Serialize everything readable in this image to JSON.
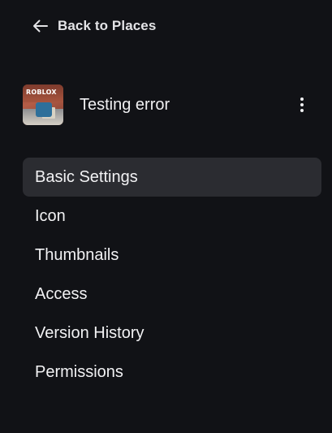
{
  "back_link": {
    "label": "Back to Places",
    "icon": "arrow-left-icon"
  },
  "place": {
    "name": "Testing error",
    "thumbnail_logo": "ROBLOX",
    "menu_icon": "more-vertical-icon"
  },
  "nav": {
    "items": [
      {
        "label": "Basic Settings",
        "active": true
      },
      {
        "label": "Icon",
        "active": false
      },
      {
        "label": "Thumbnails",
        "active": false
      },
      {
        "label": "Access",
        "active": false
      },
      {
        "label": "Version History",
        "active": false
      },
      {
        "label": "Permissions",
        "active": false
      }
    ]
  },
  "colors": {
    "background": "#111216",
    "active_item": "#2b2c31",
    "text": "#f0f0f2"
  }
}
